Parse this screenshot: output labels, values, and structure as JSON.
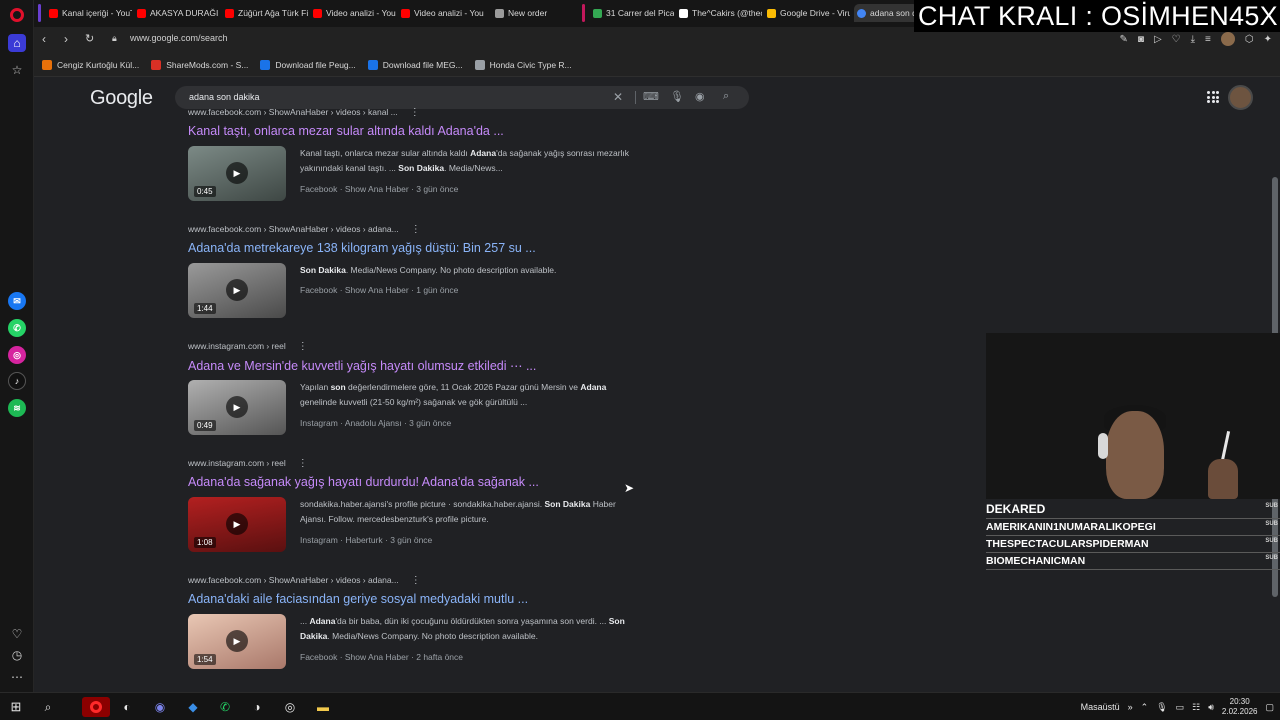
{
  "overlay": {
    "title": "CHAT KRALI : OSİMHEN45X"
  },
  "browser": {
    "tabs": [
      {
        "label": "Kanal içeriği - YouT",
        "color": "#ff0000"
      },
      {
        "label": "AKASYA DURAĞI 7",
        "color": "#ff0000"
      },
      {
        "label": "Züğürt Ağa Türk Fi",
        "color": "#ff0000"
      },
      {
        "label": "Video analizi - You",
        "color": "#ff0000"
      },
      {
        "label": "Video analizi - You",
        "color": "#ff0000"
      },
      {
        "label": "New order",
        "color": "#9b9b9b"
      },
      {
        "label": "31 Carrer del Pica-",
        "color": "#34a853"
      },
      {
        "label": "The^Cakirs (@thec",
        "color": "#ffffff"
      },
      {
        "label": "Google Drive - Viru",
        "color": "#fbbc04"
      },
      {
        "label": "adana son d",
        "color": "#4285f4"
      }
    ],
    "url": "www.google.com/search",
    "bookmarks": [
      {
        "label": "Cengiz Kurtoğlu Kül...",
        "color": "#e8710a"
      },
      {
        "label": "ShareMods.com - S...",
        "color": "#d93025"
      },
      {
        "label": "Download file Peug...",
        "color": "#1a73e8"
      },
      {
        "label": "Download file MEG...",
        "color": "#1a73e8"
      },
      {
        "label": "Honda Civic Type R...",
        "color": "#9aa0a6"
      }
    ]
  },
  "google": {
    "logo": "Google",
    "query": "adana son dakika",
    "results": [
      {
        "cite": "www.facebook.com › ShowAnaHaber › videos › kanal ...",
        "title": "Kanal taştı, onlarca mezar sular altında kaldı Adana'da ...",
        "visited": true,
        "duration": "0:45",
        "snippet_parts": [
          "Kanal taştı, onlarca mezar sular altında kaldı ",
          "Adana",
          "'da sağanak yağış sonrası mezarlık yakınındaki kanal taştı. ... ",
          "Son Dakika",
          ". Media/News..."
        ],
        "meta": "Facebook · Show Ana Haber · 3 gün önce",
        "thumb": "#5a6662"
      },
      {
        "cite": "www.facebook.com › ShowAnaHaber › videos › adana...",
        "title": "Adana'da metrekareye 138 kilogram yağış düştü: Bin 257 su ...",
        "visited": false,
        "duration": "1:44",
        "snippet_parts": [
          "",
          "Son Dakika",
          ". Media/News Company. No photo description available.",
          "",
          ""
        ],
        "meta": "Facebook · Show Ana Haber · 1 gün önce",
        "thumb": "#6b6b6b"
      },
      {
        "cite": "www.instagram.com › reel",
        "title": "Adana ve Mersin'de kuvvetli yağış hayatı olumsuz etkiledi ⋯ ...",
        "visited": true,
        "duration": "0:49",
        "snippet_parts": [
          "Yapılan ",
          "son",
          " değerlendirmelere göre, 11 Ocak 2026 Pazar günü Mersin ve ",
          "Adana",
          " genelinde kuvvetli (21-50 kg/m²) sağanak ve gök gürültülü ..."
        ],
        "meta": "Instagram · Anadolu Ajansı · 3 gün önce",
        "thumb": "#7a7a7a"
      },
      {
        "cite": "www.instagram.com › reel",
        "title": "Adana'da sağanak yağış hayatı durdurdu! Adana'da sağanak ...",
        "visited": true,
        "duration": "1:08",
        "snippet_parts": [
          "sondakika.haber.ajansi's profile picture · sondakika.haber.ajansi. ",
          "Son Dakika",
          " Haber Ajansı. Follow. mercedesbenzturk's profile picture.",
          "",
          ""
        ],
        "meta": "Instagram · Haberturk · 3 gün önce",
        "thumb": "#8a1a1a"
      },
      {
        "cite": "www.facebook.com › ShowAnaHaber › videos › adana...",
        "title": "Adana'daki aile faciasından geriye sosyal medyadaki mutlu ...",
        "visited": false,
        "duration": "1:54",
        "snippet_parts": [
          "... ",
          "Adana",
          "'da bir baba, dün iki çocuğunu öldürdükten sonra yaşamına son verdi. ... ",
          "Son Dakika",
          ". Media/News Company. No photo description available."
        ],
        "meta": "Facebook · Show Ana Haber · 2 hafta önce",
        "thumb": "#c9a28e"
      }
    ]
  },
  "stream": {
    "subs": [
      {
        "name": "DEKARED",
        "tag": "SUB"
      },
      {
        "name": "AMERIKANIN1NUMARALIKOPEGI",
        "tag": "SUB"
      },
      {
        "name": "THESPECTACULARSPIDERMAN",
        "tag": "SUB"
      },
      {
        "name": "BIOMECHANICMAN",
        "tag": "SUB"
      }
    ]
  },
  "taskbar": {
    "desktop_label": "Masaüstü",
    "time": "20:30",
    "date": "2.02.2026"
  }
}
